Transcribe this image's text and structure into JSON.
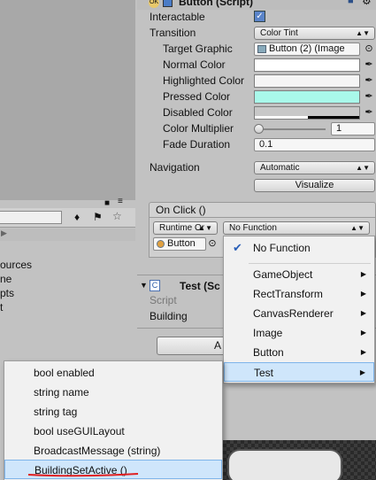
{
  "component": {
    "title": "Button (Script)"
  },
  "props": [
    {
      "label": "Interactable"
    },
    {
      "label": "Transition",
      "value": "Color Tint"
    },
    {
      "label": "Target Graphic",
      "value": "Button (2) (Image"
    },
    {
      "label": "Normal Color"
    },
    {
      "label": "Highlighted Color"
    },
    {
      "label": "Pressed Color"
    },
    {
      "label": "Disabled Color"
    },
    {
      "label": "Color Multiplier",
      "value": "1"
    },
    {
      "label": "Fade Duration",
      "value": "0.1"
    },
    {
      "label": "Navigation",
      "value": "Automatic"
    }
  ],
  "colors": {
    "normal": "#ffffff",
    "highlighted": "#f5f5f5",
    "pressed": "#a9f8ea",
    "disabled": "#c8c8c8",
    "highlight_bg": "#cfe6fb",
    "highlight_border": "#7eb4ea"
  },
  "visualize_label": "Visualize",
  "onclick": {
    "header": "On Click ()",
    "runtime": "Runtime Or",
    "function": "No Function",
    "object": "Button"
  },
  "project_panel": {
    "items": [
      "ources",
      "ne",
      "pts",
      "t"
    ]
  },
  "test_script": {
    "title": "Test (Sc",
    "rows": [
      "Script",
      "Building"
    ]
  },
  "add_button_label": "A",
  "menu1": {
    "items": [
      {
        "label": "No Function",
        "checked": true
      },
      {
        "label": "GameObject"
      },
      {
        "label": "RectTransform"
      },
      {
        "label": "CanvasRenderer"
      },
      {
        "label": "Image"
      },
      {
        "label": "Button"
      },
      {
        "label": "Test",
        "highlighted": true
      }
    ]
  },
  "menu2": {
    "items": [
      {
        "label": "bool enabled"
      },
      {
        "label": "string name"
      },
      {
        "label": "string tag"
      },
      {
        "label": "bool useGUILayout"
      },
      {
        "label": "BroadcastMessage (string)"
      },
      {
        "label": "BuildingSetActive ()",
        "highlighted": true
      }
    ]
  }
}
